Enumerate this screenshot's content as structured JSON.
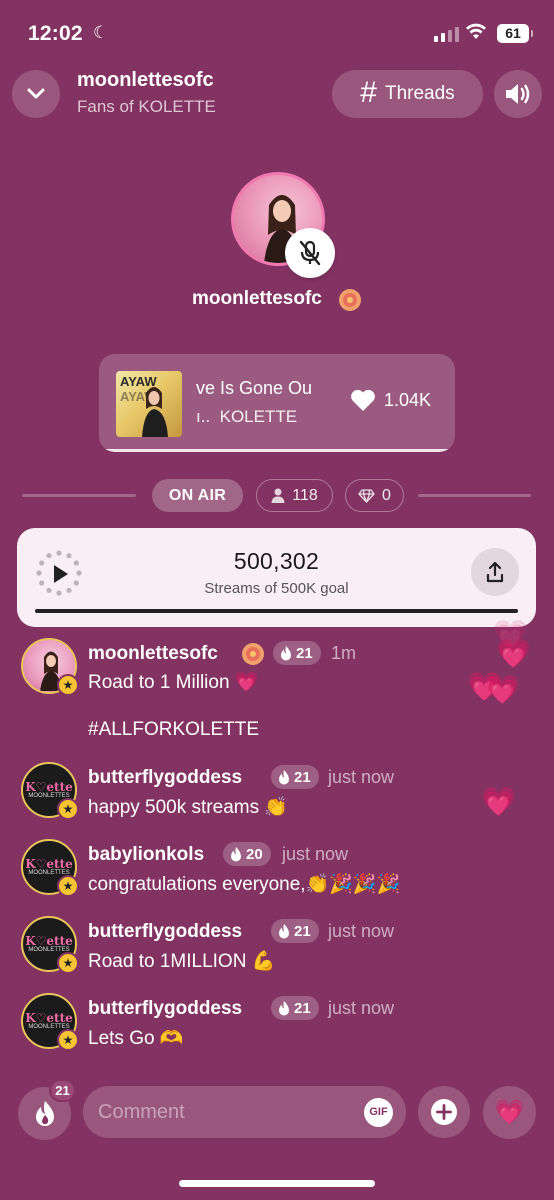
{
  "status_bar": {
    "time": "12:02",
    "battery": "61"
  },
  "header": {
    "title": "moonlettesofc",
    "subtitle": "Fans of KOLETTE",
    "threads_label": "Threads"
  },
  "host": {
    "name": "moonlettesofc"
  },
  "now_playing": {
    "title": "ve Is Gone   Ou",
    "artist": "KOLETTE",
    "artist_prefix": "ı..",
    "likes": "1.04K"
  },
  "stats": {
    "on_air_label": "ON AIR",
    "listeners": "118",
    "gems": "0"
  },
  "goal": {
    "value": "500,302",
    "caption": "Streams of 500K goal",
    "progress_fraction": 1.0
  },
  "chat": [
    {
      "user": "moonlettesofc",
      "level": "21",
      "time": "1m",
      "message": "Road to 1 Million 💗",
      "message2": "#ALLFORKOLETTE",
      "avatar": "photo"
    },
    {
      "user": "butterflygoddess",
      "level": "21",
      "time": "just now",
      "message": "happy 500k streams 👏",
      "avatar": "logo"
    },
    {
      "user": "babylionkols",
      "level": "20",
      "time": "just now",
      "message": "congratulations everyone,👏🎉🎉🎉",
      "avatar": "logo"
    },
    {
      "user": "butterflygoddess",
      "level": "21",
      "time": "just now",
      "message": "Road to 1MILLION 💪",
      "avatar": "logo"
    },
    {
      "user": "butterflygoddess",
      "level": "21",
      "time": "just now",
      "message": "Lets Go 🫶",
      "avatar": "logo"
    }
  ],
  "bottom_bar": {
    "fire_count": "21",
    "comment_placeholder": "Comment",
    "gif_label": "GIF"
  },
  "colors": {
    "background": "#833362",
    "goal_card": "#f8eef4",
    "accent_pink": "#f07ab0",
    "badge_gold": "#f4c432"
  }
}
